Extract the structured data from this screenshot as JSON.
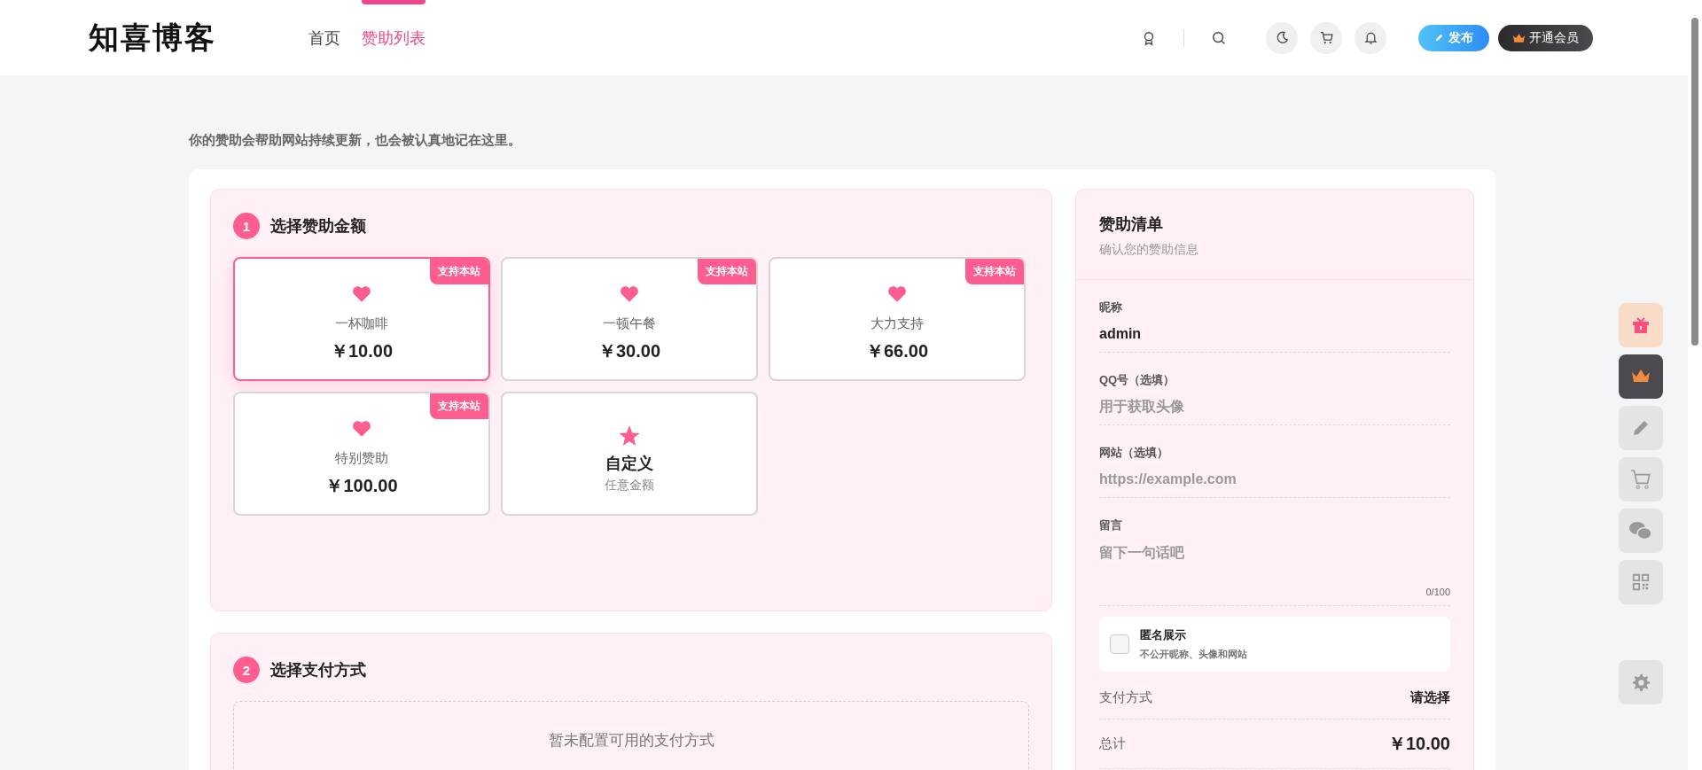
{
  "header": {
    "logo": "知喜博客",
    "nav": [
      {
        "label": "首页",
        "selected": false
      },
      {
        "label": "赞助列表",
        "selected": true
      }
    ],
    "publish_button": "发布",
    "vip_button": "开通会员"
  },
  "intro": "你的赞助会帮助网站持续更新，也会被认真地记在这里。",
  "amount_section": {
    "step": "1",
    "title": "选择赞助金额",
    "options": [
      {
        "kind": "preset",
        "badge": "支持本站",
        "name": "一杯咖啡",
        "price": "￥10.00",
        "selected": true
      },
      {
        "kind": "preset",
        "badge": "支持本站",
        "name": "一顿午餐",
        "price": "￥30.00",
        "selected": false
      },
      {
        "kind": "preset",
        "badge": "支持本站",
        "name": "大力支持",
        "price": "￥66.00",
        "selected": false
      },
      {
        "kind": "preset",
        "badge": "支持本站",
        "name": "特别赞助",
        "price": "￥100.00",
        "selected": false
      },
      {
        "kind": "custom",
        "name": "自定义",
        "hint": "任意金额",
        "selected": false
      }
    ]
  },
  "payment_section": {
    "step": "2",
    "title": "选择支付方式",
    "empty_text": "暂未配置可用的支付方式"
  },
  "summary": {
    "title": "赞助清单",
    "subtitle": "确认您的赞助信息",
    "fields": [
      {
        "kind": "input",
        "label": "昵称",
        "value": "admin"
      },
      {
        "kind": "input",
        "label": "QQ号（选填）",
        "placeholder": "用于获取头像"
      },
      {
        "kind": "input",
        "label": "网站（选填）",
        "placeholder": "https://example.com"
      },
      {
        "kind": "textarea",
        "label": "留言",
        "placeholder": "留下一句话吧",
        "counter": "0/100"
      }
    ],
    "anonymous": {
      "title": "匿名展示",
      "description": "不公开昵称、头像和网站",
      "checked": false
    },
    "rows": [
      {
        "kind": "plain",
        "label": "支付方式",
        "value": "请选择"
      },
      {
        "kind": "total",
        "label": "总计",
        "value": "￥10.00"
      }
    ]
  },
  "side_tools": [
    {
      "kind": "gift"
    },
    {
      "kind": "crown"
    },
    {
      "kind": "pencil"
    },
    {
      "kind": "cart"
    },
    {
      "kind": "chat"
    },
    {
      "kind": "qrcode"
    },
    {
      "kind": "gear"
    }
  ]
}
